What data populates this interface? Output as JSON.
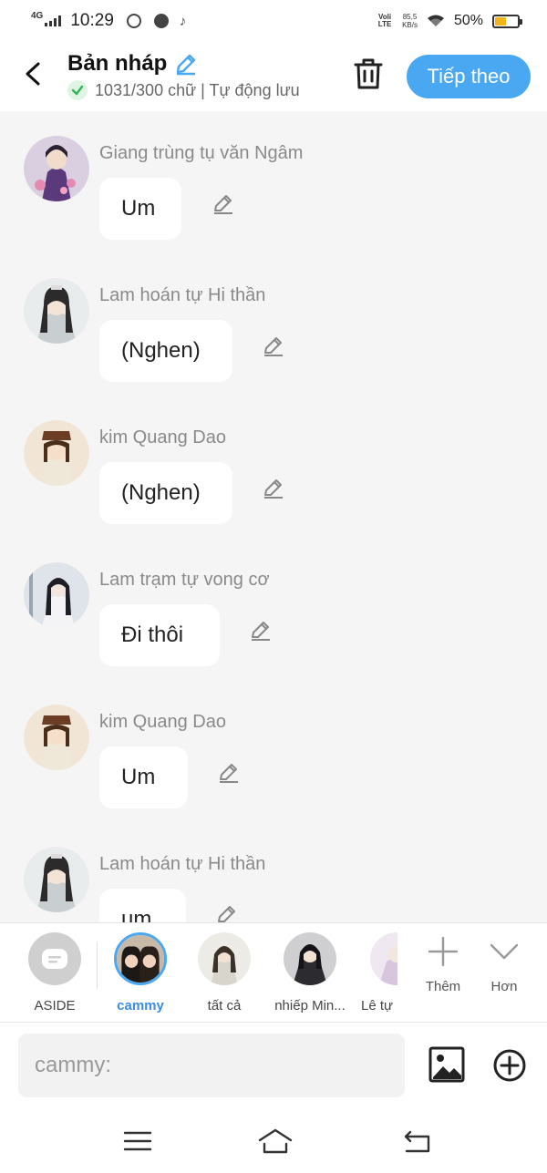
{
  "status_bar": {
    "network": "4G",
    "time": "10:29",
    "volte": "Voli LTE",
    "speed_value": "85,5",
    "speed_unit": "KB/s",
    "battery_pct": "50%",
    "battery_level": 0.5,
    "icons": [
      "signal-icon",
      "messenger-icon",
      "chat-icon",
      "tiktok-icon",
      "wifi-icon",
      "battery-icon"
    ]
  },
  "header": {
    "title": "Bản nháp",
    "subtitle": "1031/300 chữ | Tự động lưu",
    "next_label": "Tiếp theo"
  },
  "messages": [
    {
      "name": "Giang trùng tụ văn Ngâm",
      "text": "Um"
    },
    {
      "name": "Lam hoán tự Hi thần",
      "text": "(Nghen)"
    },
    {
      "name": "kim Quang Dao",
      "text": "(Nghen)"
    },
    {
      "name": "Lam trạm tự vong cơ",
      "text": "Đi thôi"
    },
    {
      "name": "kim Quang Dao",
      "text": "Um"
    },
    {
      "name": "Lam hoán tự Hi thần",
      "text": "um"
    }
  ],
  "characters": [
    {
      "label": "ASIDE"
    },
    {
      "label": "cammy",
      "selected": true
    },
    {
      "label": "tất cả"
    },
    {
      "label": "nhiếp Min..."
    },
    {
      "label": "Lê tự"
    }
  ],
  "tools": {
    "add_label": "Thêm",
    "more_label": "Hơn"
  },
  "input": {
    "placeholder": "cammy:"
  },
  "colors": {
    "accent": "#4aa8f2",
    "background": "#f5f5f5",
    "name_gray": "#8a8a8a",
    "battery": "#f2b416"
  }
}
